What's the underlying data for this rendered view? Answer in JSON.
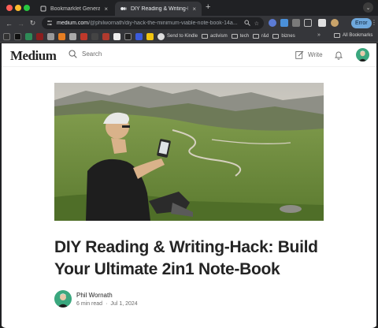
{
  "browser": {
    "tabs": [
      {
        "title": "Bookmarklet Generator"
      },
      {
        "title": "DIY Reading & Writing-Hack"
      }
    ],
    "new_tab": "+",
    "tab_close": "×",
    "url_host": "medium.com",
    "url_path": "/@philwornath/diy-hack-the-minimum-viable-note-book-14a...",
    "error_label": "Error"
  },
  "bookmarks": {
    "items": [
      {
        "label": "Send to Kindle",
        "icon": "kindle-icon"
      },
      {
        "label": "activism",
        "icon": "folder-icon"
      },
      {
        "label": "tech",
        "icon": "folder-icon"
      },
      {
        "label": "r&d",
        "icon": "folder-icon"
      },
      {
        "label": "biznes",
        "icon": "folder-icon"
      }
    ],
    "more": "»",
    "all": "All Bookmarks"
  },
  "header": {
    "logo": "Medium",
    "search_placeholder": "Search",
    "write_label": "Write"
  },
  "article": {
    "title": "DIY Reading & Writing-Hack: Build Your Ultimate 2in1 Note-Book",
    "author": "Phil Wornath",
    "read_time": "6 min read",
    "separator": "·",
    "date": "Jul 1, 2024"
  }
}
